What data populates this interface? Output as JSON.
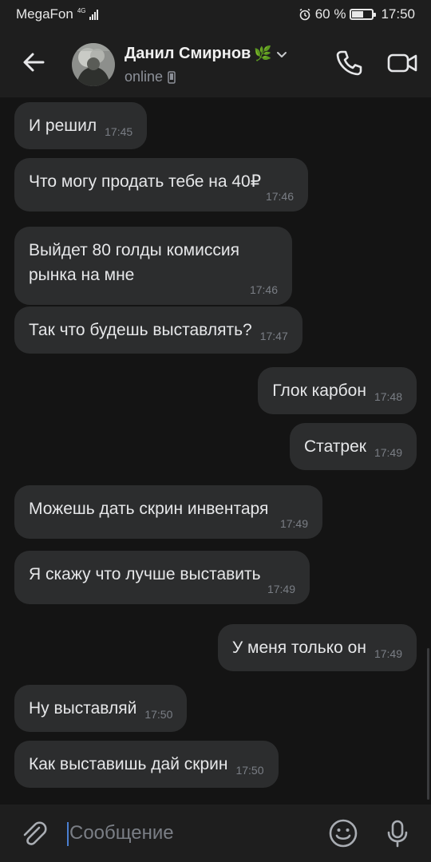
{
  "status_bar": {
    "carrier": "MegaFon",
    "network": "4G",
    "battery": "60 %",
    "battery_level": 0.6,
    "time": "17:50"
  },
  "header": {
    "contact_name": "Данил Смирнов",
    "name_emoji": "🌿",
    "status": "online",
    "icons": [
      "back-arrow-icon",
      "chevron-down-icon",
      "phone-icon",
      "video-camera-icon",
      "mobile-device-icon"
    ]
  },
  "messages": [
    {
      "side": "in",
      "text": "И решил",
      "time": "17:45"
    },
    {
      "side": "in",
      "text": "Что могу продать тебе на 40₽",
      "time": "17:46"
    },
    {
      "side": "in",
      "text": "Выйдет 80 голды комиссия рынка на мне",
      "time": "17:46"
    },
    {
      "side": "in",
      "text": "Так что будешь выставлять?",
      "time": "17:47"
    },
    {
      "side": "out",
      "text": "Глок карбон",
      "time": "17:48"
    },
    {
      "side": "out",
      "text": "Статрек",
      "time": "17:49"
    },
    {
      "side": "in",
      "text": "Можешь дать скрин инвентаря",
      "time": "17:49"
    },
    {
      "side": "in",
      "text": "Я скажу что лучше выставить",
      "time": "17:49"
    },
    {
      "side": "out",
      "text": "У меня только он",
      "time": "17:49"
    },
    {
      "side": "in",
      "text": "Ну выставляй",
      "time": "17:50"
    },
    {
      "side": "in",
      "text": "Как выставишь дай скрин",
      "time": "17:50"
    }
  ],
  "composer": {
    "placeholder": "Сообщение",
    "icons": [
      "paperclip-icon",
      "emoji-icon",
      "microphone-icon"
    ]
  },
  "colors": {
    "background": "#141414",
    "bar": "#1e1e1e",
    "bubble": "#2c2d2e",
    "accent": "#4a7fd1"
  }
}
